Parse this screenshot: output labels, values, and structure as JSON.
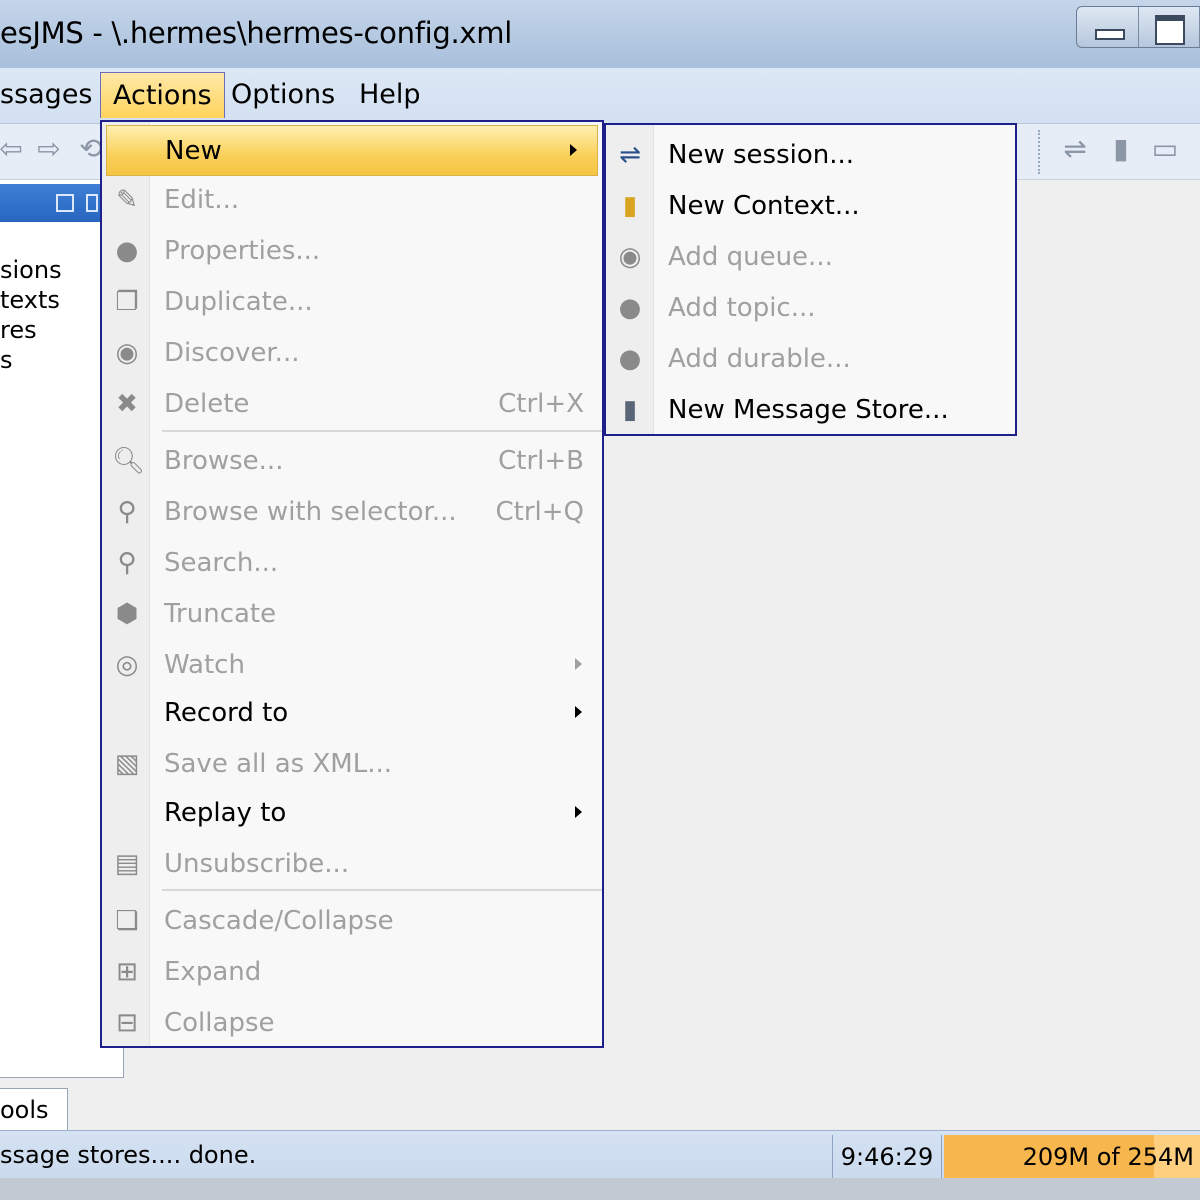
{
  "window": {
    "title": "esJMS - \\.hermes\\hermes-config.xml"
  },
  "menubar": {
    "items": [
      {
        "label": "ssages"
      },
      {
        "label": "Actions"
      },
      {
        "label": "Options"
      },
      {
        "label": "Help"
      }
    ]
  },
  "left_panel": {
    "tree_items": [
      "sions",
      "texts",
      "res",
      "s"
    ]
  },
  "actions_menu": {
    "items": [
      {
        "label": "New",
        "shortcut": "",
        "icon": "",
        "enabled": true,
        "submenu": true
      },
      {
        "label": "Edit...",
        "shortcut": "",
        "icon": "edit-icon",
        "enabled": false
      },
      {
        "label": "Properties...",
        "shortcut": "",
        "icon": "properties-icon",
        "enabled": false
      },
      {
        "label": "Duplicate...",
        "shortcut": "",
        "icon": "duplicate-icon",
        "enabled": false
      },
      {
        "label": "Discover...",
        "shortcut": "",
        "icon": "discover-icon",
        "enabled": false
      },
      {
        "label": "Delete",
        "shortcut": "Ctrl+X",
        "icon": "delete-icon",
        "enabled": false
      },
      {
        "label": "Browse...",
        "shortcut": "Ctrl+B",
        "icon": "browse-icon",
        "enabled": false
      },
      {
        "label": "Browse with selector...",
        "shortcut": "Ctrl+Q",
        "icon": "browse-selector-icon",
        "enabled": false
      },
      {
        "label": "Search...",
        "shortcut": "",
        "icon": "search-icon",
        "enabled": false
      },
      {
        "label": "Truncate",
        "shortcut": "",
        "icon": "truncate-icon",
        "enabled": false
      },
      {
        "label": "Watch",
        "shortcut": "",
        "icon": "watch-icon",
        "enabled": false,
        "submenu": true
      },
      {
        "label": "Record to",
        "shortcut": "",
        "icon": "",
        "enabled": true,
        "submenu": true
      },
      {
        "label": "Save all as XML...",
        "shortcut": "",
        "icon": "save-xml-icon",
        "enabled": false
      },
      {
        "label": "Replay to",
        "shortcut": "",
        "icon": "",
        "enabled": true,
        "submenu": true
      },
      {
        "label": "Unsubscribe...",
        "shortcut": "",
        "icon": "unsubscribe-icon",
        "enabled": false
      },
      {
        "label": "Cascade/Collapse",
        "shortcut": "",
        "icon": "cascade-icon",
        "enabled": false
      },
      {
        "label": "Expand",
        "shortcut": "",
        "icon": "expand-icon",
        "enabled": false
      },
      {
        "label": "Collapse",
        "shortcut": "",
        "icon": "collapse-icon",
        "enabled": false
      }
    ]
  },
  "new_submenu": {
    "items": [
      {
        "label": "New session...",
        "icon": "session-icon",
        "enabled": true
      },
      {
        "label": "New Context...",
        "icon": "context-icon",
        "enabled": true
      },
      {
        "label": "Add queue...",
        "icon": "queue-icon",
        "enabled": false
      },
      {
        "label": "Add topic...",
        "icon": "topic-icon",
        "enabled": false
      },
      {
        "label": "Add durable...",
        "icon": "durable-icon",
        "enabled": false
      },
      {
        "label": "New Message Store...",
        "icon": "message-store-icon",
        "enabled": true
      }
    ]
  },
  "bottom_tab": {
    "label": "ools"
  },
  "statusbar": {
    "message": "ssage stores.... done.",
    "time": "9:46:29",
    "memory": "209M of 254M",
    "memory_used_fraction": 0.82
  }
}
